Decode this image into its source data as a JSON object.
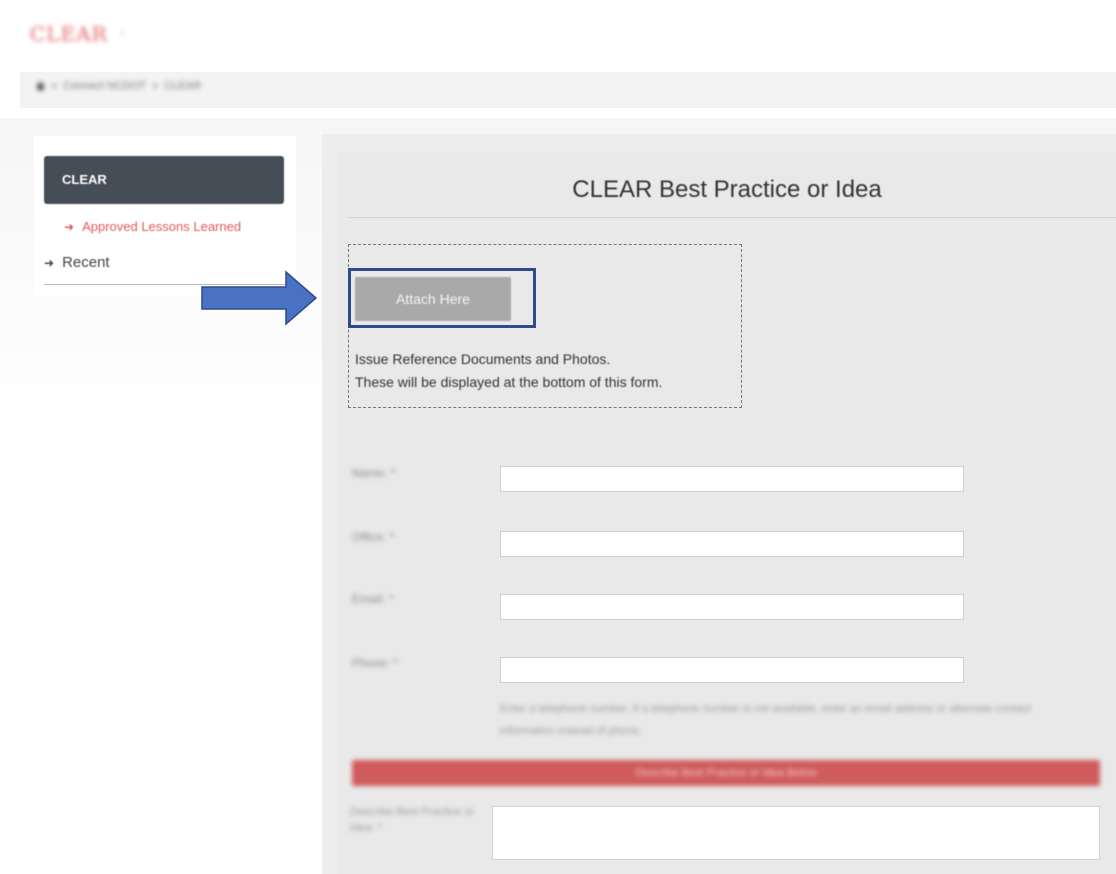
{
  "header": {
    "brand": "CLEAR",
    "brand_separator": "›",
    "breadcrumb": {
      "home_icon": "home-icon",
      "separator": "»",
      "items": [
        "Connect NCDOT",
        "CLEAR"
      ]
    }
  },
  "sidebar": {
    "header": "CLEAR",
    "items": [
      {
        "label": "Approved Lessons Learned",
        "icon": "arrow-right-icon",
        "color": "#e05a5a"
      },
      {
        "label": "Recent",
        "icon": "arrow-right-icon",
        "color": "#444444"
      }
    ]
  },
  "form": {
    "title": "CLEAR Best Practice or Idea",
    "attach": {
      "button_label": "Attach Here",
      "help_line_1": "Issue Reference Documents and Photos.",
      "help_line_2": "These will be displayed at the bottom of this form."
    },
    "fields": [
      {
        "label": "Name: *",
        "value": ""
      },
      {
        "label": "Office: *",
        "value": ""
      },
      {
        "label": "Email: *",
        "value": ""
      },
      {
        "label": "Phone: *",
        "value": ""
      }
    ],
    "help_text": "Enter a telephone number. If a telephone number is not available, enter an email address or alternate contact information instead of phone.",
    "section_bar": "Describe Best Practice or Idea Below",
    "lower_field_label": "Describe Best Practice or Idea: *"
  },
  "annotation": {
    "callout_color": "#4a72c4",
    "highlight_color": "#2e4b8c"
  }
}
